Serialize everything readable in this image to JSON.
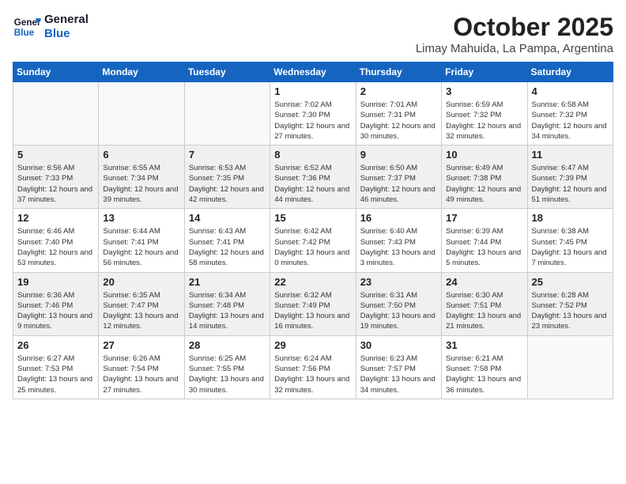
{
  "header": {
    "logo_line1": "General",
    "logo_line2": "Blue",
    "month": "October 2025",
    "location": "Limay Mahuida, La Pampa, Argentina"
  },
  "weekdays": [
    "Sunday",
    "Monday",
    "Tuesday",
    "Wednesday",
    "Thursday",
    "Friday",
    "Saturday"
  ],
  "weeks": [
    [
      {
        "day": "",
        "empty": true
      },
      {
        "day": "",
        "empty": true
      },
      {
        "day": "",
        "empty": true
      },
      {
        "day": "1",
        "sunrise": "7:02 AM",
        "sunset": "7:30 PM",
        "daylight": "12 hours and 27 minutes."
      },
      {
        "day": "2",
        "sunrise": "7:01 AM",
        "sunset": "7:31 PM",
        "daylight": "12 hours and 30 minutes."
      },
      {
        "day": "3",
        "sunrise": "6:59 AM",
        "sunset": "7:32 PM",
        "daylight": "12 hours and 32 minutes."
      },
      {
        "day": "4",
        "sunrise": "6:58 AM",
        "sunset": "7:32 PM",
        "daylight": "12 hours and 34 minutes."
      }
    ],
    [
      {
        "day": "5",
        "sunrise": "6:56 AM",
        "sunset": "7:33 PM",
        "daylight": "12 hours and 37 minutes."
      },
      {
        "day": "6",
        "sunrise": "6:55 AM",
        "sunset": "7:34 PM",
        "daylight": "12 hours and 39 minutes."
      },
      {
        "day": "7",
        "sunrise": "6:53 AM",
        "sunset": "7:35 PM",
        "daylight": "12 hours and 42 minutes."
      },
      {
        "day": "8",
        "sunrise": "6:52 AM",
        "sunset": "7:36 PM",
        "daylight": "12 hours and 44 minutes."
      },
      {
        "day": "9",
        "sunrise": "6:50 AM",
        "sunset": "7:37 PM",
        "daylight": "12 hours and 46 minutes."
      },
      {
        "day": "10",
        "sunrise": "6:49 AM",
        "sunset": "7:38 PM",
        "daylight": "12 hours and 49 minutes."
      },
      {
        "day": "11",
        "sunrise": "6:47 AM",
        "sunset": "7:39 PM",
        "daylight": "12 hours and 51 minutes."
      }
    ],
    [
      {
        "day": "12",
        "sunrise": "6:46 AM",
        "sunset": "7:40 PM",
        "daylight": "12 hours and 53 minutes."
      },
      {
        "day": "13",
        "sunrise": "6:44 AM",
        "sunset": "7:41 PM",
        "daylight": "12 hours and 56 minutes."
      },
      {
        "day": "14",
        "sunrise": "6:43 AM",
        "sunset": "7:41 PM",
        "daylight": "12 hours and 58 minutes."
      },
      {
        "day": "15",
        "sunrise": "6:42 AM",
        "sunset": "7:42 PM",
        "daylight": "13 hours and 0 minutes."
      },
      {
        "day": "16",
        "sunrise": "6:40 AM",
        "sunset": "7:43 PM",
        "daylight": "13 hours and 3 minutes."
      },
      {
        "day": "17",
        "sunrise": "6:39 AM",
        "sunset": "7:44 PM",
        "daylight": "13 hours and 5 minutes."
      },
      {
        "day": "18",
        "sunrise": "6:38 AM",
        "sunset": "7:45 PM",
        "daylight": "13 hours and 7 minutes."
      }
    ],
    [
      {
        "day": "19",
        "sunrise": "6:36 AM",
        "sunset": "7:46 PM",
        "daylight": "13 hours and 9 minutes."
      },
      {
        "day": "20",
        "sunrise": "6:35 AM",
        "sunset": "7:47 PM",
        "daylight": "13 hours and 12 minutes."
      },
      {
        "day": "21",
        "sunrise": "6:34 AM",
        "sunset": "7:48 PM",
        "daylight": "13 hours and 14 minutes."
      },
      {
        "day": "22",
        "sunrise": "6:32 AM",
        "sunset": "7:49 PM",
        "daylight": "13 hours and 16 minutes."
      },
      {
        "day": "23",
        "sunrise": "6:31 AM",
        "sunset": "7:50 PM",
        "daylight": "13 hours and 19 minutes."
      },
      {
        "day": "24",
        "sunrise": "6:30 AM",
        "sunset": "7:51 PM",
        "daylight": "13 hours and 21 minutes."
      },
      {
        "day": "25",
        "sunrise": "6:28 AM",
        "sunset": "7:52 PM",
        "daylight": "13 hours and 23 minutes."
      }
    ],
    [
      {
        "day": "26",
        "sunrise": "6:27 AM",
        "sunset": "7:53 PM",
        "daylight": "13 hours and 25 minutes."
      },
      {
        "day": "27",
        "sunrise": "6:26 AM",
        "sunset": "7:54 PM",
        "daylight": "13 hours and 27 minutes."
      },
      {
        "day": "28",
        "sunrise": "6:25 AM",
        "sunset": "7:55 PM",
        "daylight": "13 hours and 30 minutes."
      },
      {
        "day": "29",
        "sunrise": "6:24 AM",
        "sunset": "7:56 PM",
        "daylight": "13 hours and 32 minutes."
      },
      {
        "day": "30",
        "sunrise": "6:23 AM",
        "sunset": "7:57 PM",
        "daylight": "13 hours and 34 minutes."
      },
      {
        "day": "31",
        "sunrise": "6:21 AM",
        "sunset": "7:58 PM",
        "daylight": "13 hours and 36 minutes."
      },
      {
        "day": "",
        "empty": true
      }
    ]
  ]
}
